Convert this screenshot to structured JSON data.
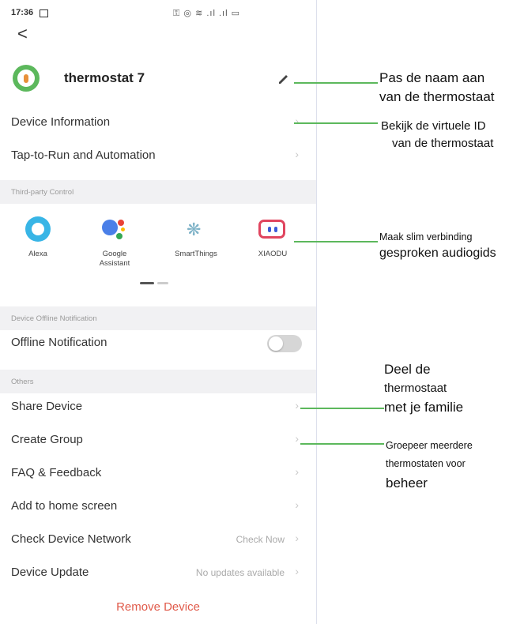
{
  "status_bar": {
    "time": "17:36",
    "system_icons": "⚿ ◎ ≋ .ıl .ıl ▭"
  },
  "header": {
    "back_symbol": "<"
  },
  "device": {
    "name": "thermostat 7",
    "edit_symbol": "✎"
  },
  "rows_top": [
    {
      "label": "Device Information",
      "arrow": "›"
    },
    {
      "label": "Tap-to-Run and Automation",
      "arrow": "›"
    }
  ],
  "third_party": {
    "section_title": "Third-party Control",
    "assistants": [
      {
        "name": "Alexa",
        "icon": "alexa-logo"
      },
      {
        "name": "Google\nAssistant",
        "icon": "google-assistant-logo"
      },
      {
        "name": "SmartThings",
        "icon": "smartthings-logo"
      },
      {
        "name": "XIAODU",
        "icon": "xiaodu-logo"
      }
    ]
  },
  "offline": {
    "section_title": "Device Offline Notification",
    "label": "Offline Notification",
    "enabled": false
  },
  "others": {
    "section_title": "Others",
    "rows": [
      {
        "label": "Share Device",
        "value": "",
        "arrow": "›"
      },
      {
        "label": "Create Group",
        "value": "",
        "arrow": "›"
      },
      {
        "label": "FAQ & Feedback",
        "value": "",
        "arrow": "›"
      },
      {
        "label": "Add to home screen",
        "value": "",
        "arrow": "›"
      },
      {
        "label": "Check Device Network",
        "value": "Check Now",
        "arrow": "›"
      },
      {
        "label": "Device Update",
        "value": "No updates available",
        "arrow": "›"
      }
    ]
  },
  "remove_label": "Remove Device",
  "annotations": {
    "rename": [
      "Pas de naam aan",
      "van de thermostaat"
    ],
    "virtual_id": [
      "Bekijk de virtuele ID",
      "van de thermostaat"
    ],
    "smart": [
      "Maak slim verbinding",
      "gesproken audiogids"
    ],
    "share": [
      "Deel de",
      "thermostaat",
      "met je familie"
    ],
    "group": [
      "Groepeer meerdere",
      "thermostaten voor",
      "beheer"
    ]
  },
  "colors": {
    "accent_green": "#5cb85c",
    "remove_red": "#e05a4a",
    "section_bg": "#f1f1f3"
  }
}
